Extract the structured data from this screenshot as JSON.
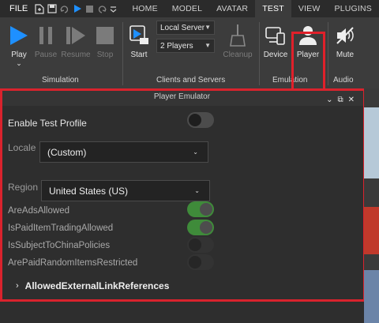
{
  "menubar": {
    "file_label": "FILE",
    "icons": [
      "new-file-icon",
      "save-icon",
      "redo-icon",
      "play-icon",
      "stop-icon",
      "undo-icon",
      "dropdown-icon"
    ],
    "tabs": [
      {
        "label": "HOME",
        "active": false
      },
      {
        "label": "MODEL",
        "active": false
      },
      {
        "label": "AVATAR",
        "active": false
      },
      {
        "label": "TEST",
        "active": true
      },
      {
        "label": "VIEW",
        "active": false
      },
      {
        "label": "PLUGINS",
        "active": false
      }
    ]
  },
  "ribbon": {
    "simulation": {
      "group_label": "Simulation",
      "play_label": "Play",
      "pause_label": "Pause",
      "resume_label": "Resume",
      "stop_label": "Stop"
    },
    "clients_servers": {
      "group_label": "Clients and Servers",
      "start_label": "Start",
      "server_select": "Local Server",
      "players_select": "2 Players",
      "cleanup_label": "Cleanup"
    },
    "emulation": {
      "group_label": "Emulation",
      "device_label": "Device",
      "player_label": "Player"
    },
    "audio": {
      "group_label": "Audio",
      "mute_label": "Mute"
    }
  },
  "panel": {
    "title": "Player Emulator",
    "enable_test_profile_label": "Enable Test Profile",
    "enable_test_profile_on": false,
    "locale_label": "Locale",
    "locale_value": "(Custom)",
    "region_label": "Region",
    "region_value": "United States (US)",
    "properties": [
      {
        "label": "AreAdsAllowed",
        "state": "on"
      },
      {
        "label": "IsPaidItemTradingAllowed",
        "state": "on"
      },
      {
        "label": "IsSubjectToChinaPolicies",
        "state": "disabled"
      },
      {
        "label": "ArePaidRandomItemsRestricted",
        "state": "disabled"
      }
    ],
    "links_section_label": "AllowedExternalLinkReferences"
  },
  "colors": {
    "highlight": "#e0202a",
    "accent_blue": "#1e90ff",
    "toggle_on": "#3f8b3a"
  }
}
